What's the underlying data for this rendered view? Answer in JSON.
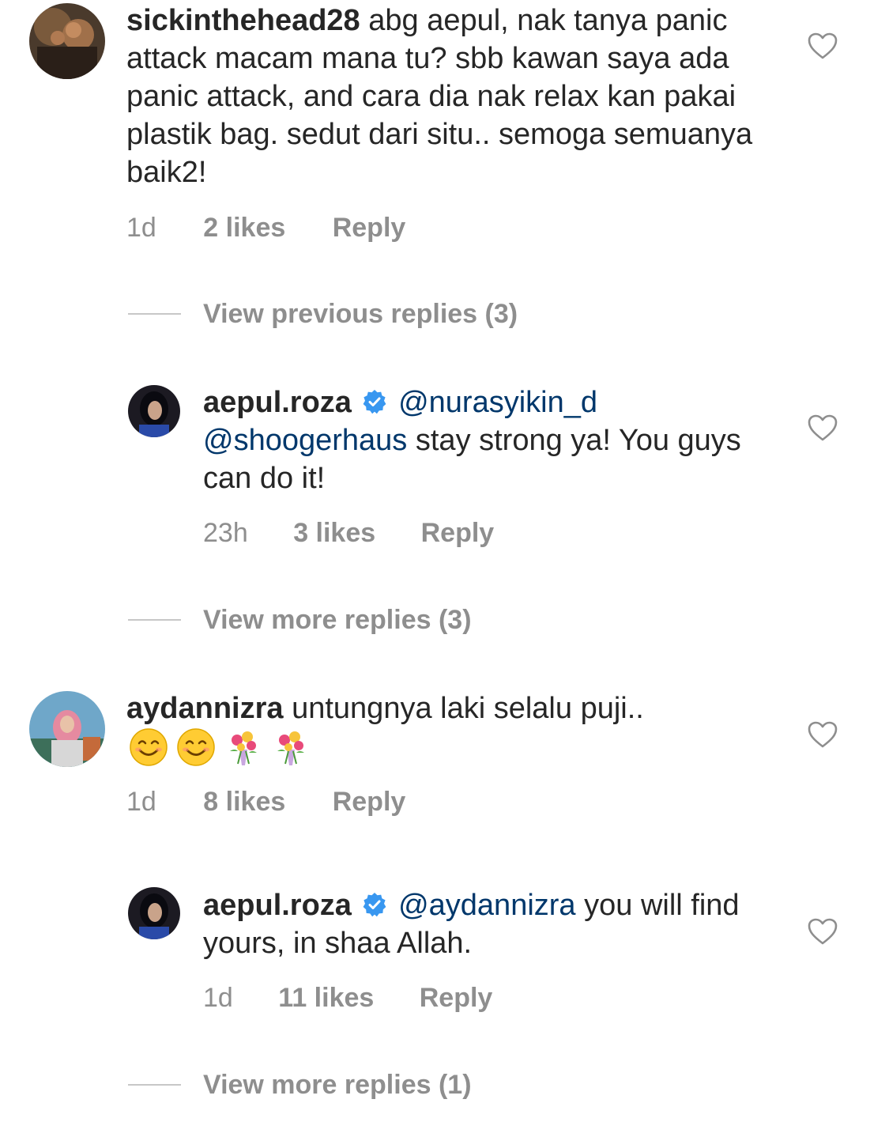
{
  "comments": [
    {
      "username": "sickinthehead28",
      "text": "abg aepul, nak tanya panic attack macam mana tu? sbb kawan saya ada panic attack, and cara dia nak relax kan pakai plastik bag. sedut dari situ.. semoga semuanya baik2!",
      "time": "1d",
      "likes": "2 likes",
      "reply": "Reply"
    },
    {
      "username": "aepul.roza",
      "verified": true,
      "mention1": "@nurasyikin_d",
      "mention2": "@shoogerhaus",
      "text": "stay strong ya! You guys can do it!",
      "time": "23h",
      "likes": "3 likes",
      "reply": "Reply"
    },
    {
      "username": "aydannizra",
      "text": "untungnya laki selalu puji..",
      "emojis": [
        "smiling-face-emoji",
        "smiling-face-emoji",
        "bouquet-emoji",
        "bouquet-emoji"
      ],
      "time": "1d",
      "likes": "8 likes",
      "reply": "Reply"
    },
    {
      "username": "aepul.roza",
      "verified": true,
      "mention1": "@aydannizra",
      "text": "you will find yours, in shaa Allah.",
      "time": "1d",
      "likes": "11 likes",
      "reply": "Reply"
    }
  ],
  "view_previous": "View previous replies (3)",
  "view_more_1": "View more replies (3)",
  "view_more_2": "View more replies (1)",
  "colors": {
    "text": "#262626",
    "meta": "#8e8e8e",
    "mention": "#00376b",
    "verified": "#3897f0",
    "divider": "#c7c7c7"
  },
  "icons": {
    "like": "heart-outline-icon",
    "verified": "verified-badge-icon"
  }
}
